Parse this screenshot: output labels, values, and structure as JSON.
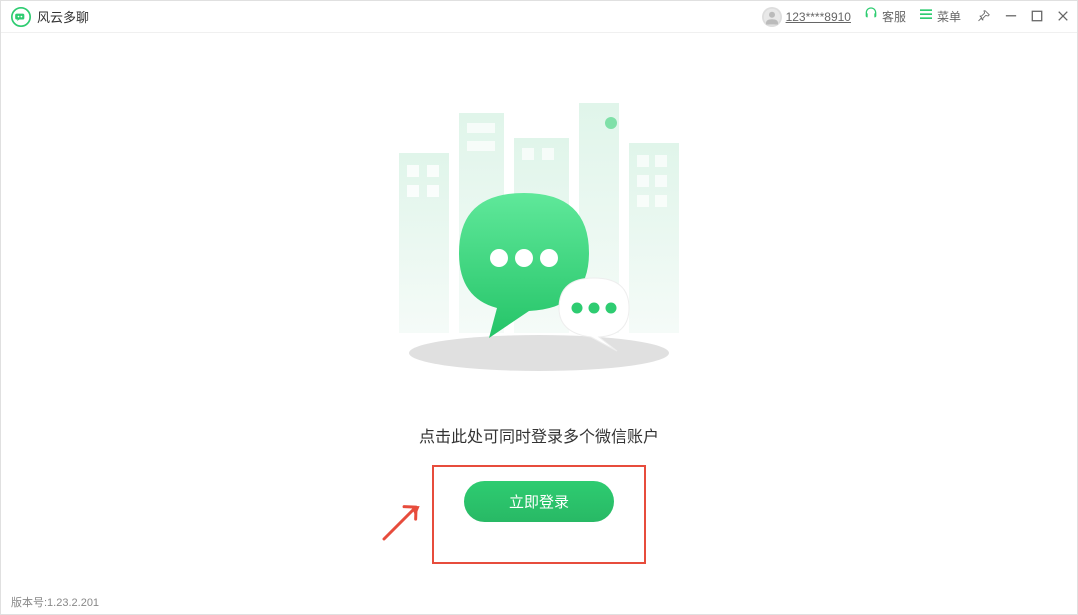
{
  "app": {
    "title": "风云多聊"
  },
  "header": {
    "user_id": "123****8910",
    "service_label": "客服",
    "menu_label": "菜单"
  },
  "main": {
    "instruction": "点击此处可同时登录多个微信账户",
    "login_button": "立即登录"
  },
  "footer": {
    "version": "版本号:1.23.2.201"
  },
  "colors": {
    "accent_green": "#2ecc71",
    "annotation_red": "#e74c3c"
  }
}
